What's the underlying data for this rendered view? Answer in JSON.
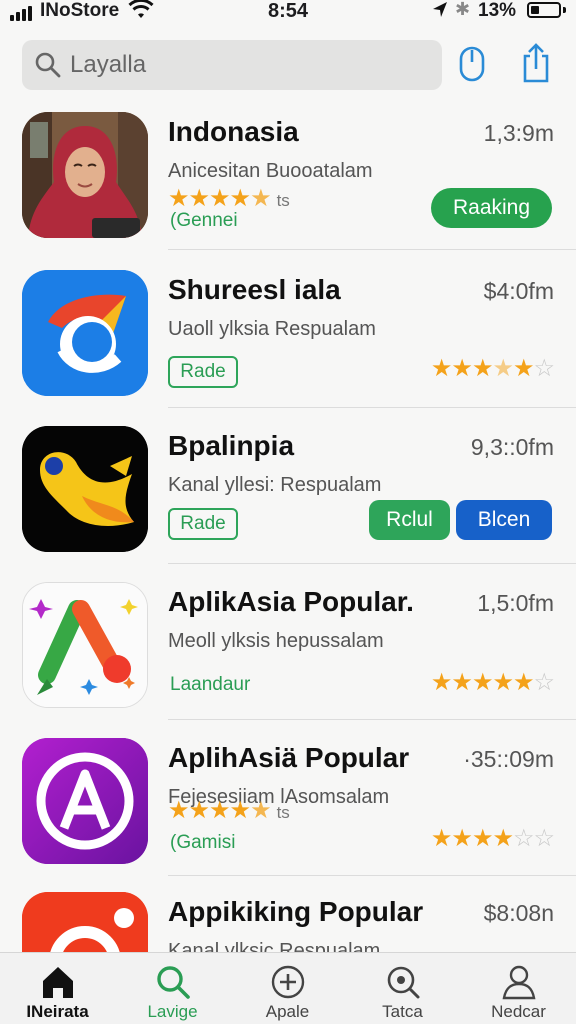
{
  "status_bar": {
    "carrier": "INoStore",
    "time": "8:54",
    "battery": "13%"
  },
  "search": {
    "placeholder": "Layalla",
    "icon": "search-icon"
  },
  "header_icons": [
    "mouse-icon",
    "share-icon"
  ],
  "apps": [
    {
      "name": "Indonasia",
      "price": "1,3:9m",
      "subtitle": "Anicesitan Buooatalam",
      "rating_left": 4.5,
      "rating_count": "ts",
      "genre": "(Gennei",
      "button": "Raaking",
      "button_color": "#27a24e"
    },
    {
      "name": "Shureesl iala",
      "price": "$4:0fm",
      "subtitle": "Uaoll ylksia Respualam",
      "tag": "Rade",
      "rating_right": 3.5
    },
    {
      "name": "Bpalinpia",
      "price": "9,3::0fm",
      "subtitle": "Kanal yllesi: Respualam",
      "tag": "Rade",
      "button_green": "Rclul",
      "button_blue": "Blcen",
      "green": "#2ea55a",
      "blue": "#1761c9"
    },
    {
      "name": "AplikAsia Popular.",
      "price": "1,5:0fm",
      "subtitle": "Meoll ylksis hepussalam",
      "genre": "Laandaur",
      "rating_right": 5
    },
    {
      "name": "AplihAsiä Popular",
      "price": "·35::09m",
      "subtitle": "Fejesesiiam lAsomsalam",
      "rating_left": 4.5,
      "rating_count": "ts",
      "genre": "(Gamisi",
      "rating_right": 4
    },
    {
      "name": "Appikiking Popular",
      "price": "$8:08n",
      "subtitle": "Kanal ylksic Respualam"
    }
  ],
  "tabs": [
    {
      "label": "INeirata",
      "icon": "home-icon",
      "active": false
    },
    {
      "label": "Lavige",
      "icon": "search-icon",
      "active": true
    },
    {
      "label": "Apale",
      "icon": "plus-icon",
      "active": false
    },
    {
      "label": "Tatca",
      "icon": "magnifier-icon",
      "active": false
    },
    {
      "label": "Nedcar",
      "icon": "profile-icon",
      "active": false
    }
  ],
  "colors": {
    "accent_green": "#2a9d54",
    "star": "#f4a21a",
    "header_icon_blue": "#2a8bd6"
  }
}
